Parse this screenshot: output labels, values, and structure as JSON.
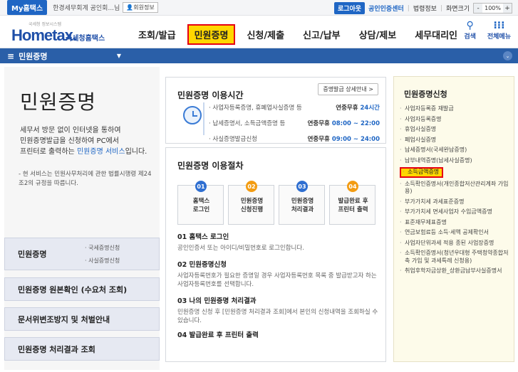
{
  "topbar": {
    "myhome": "My홈택스",
    "user": "한경세무회계 공인회...님",
    "member_info": "회원정보",
    "logout": "로그아웃",
    "cert_center": "공인인증센터",
    "law_info": "법령정보",
    "screen_size": "화면크기",
    "zoom_minus": "-",
    "zoom_value": "100%",
    "zoom_plus": "+"
  },
  "header": {
    "logo_small": "국세청 정보시스템",
    "logo_main": "Hometax.",
    "logo_sub": "국세청홈택스",
    "menu": [
      "조회/발급",
      "민원증명",
      "신청/제출",
      "신고/납부",
      "상담/제보",
      "세무대리인"
    ],
    "active_index": 1,
    "search": "검색",
    "all_menu": "전체메뉴"
  },
  "navbar": {
    "label": "민원증명"
  },
  "left": {
    "title": "민원증명",
    "desc_1": "세무서 방문 없이 인터넷을 통하여",
    "desc_2": "민원증명발급을 신청하여 PC에서",
    "desc_3a": "프린터로 출력하는 ",
    "desc_3b": "민원증명 서비스",
    "desc_3c": "입니다.",
    "note": "- 현 서비스는 민원사무처리에 관한 법률시행령 제24조2의 규정을 따릅니다.",
    "box1_label": "민원증명",
    "box1_sub1": "· 국세증명신청",
    "box1_sub2": "· 사실증명신청",
    "box2": "민원증명 원본확인 (수요처 조회)",
    "box3": "문서위변조방지 및 처벌안내",
    "box4": "민원증명 처리결과 조회"
  },
  "hours": {
    "title": "민원증명 이용시간",
    "detail_btn": "증명발급 상세안내 >",
    "rows": [
      {
        "k": "· 사업자등록증명, 휴폐업사실증명 등",
        "v1": "연중무휴 ",
        "v2": "24시간"
      },
      {
        "k": "· 납세증명서, 소득금액증명 등",
        "v1": "연중무휴 ",
        "v2": "08:00 ~ 22:00"
      },
      {
        "k": "· 사실증명발급신청",
        "v1": "연중무휴 ",
        "v2": "09:00 ~ 24:00"
      }
    ]
  },
  "procedure": {
    "title": "민원증명 이용절차",
    "steps": [
      {
        "num": "01",
        "l1": "홈택스",
        "l2": "로그인"
      },
      {
        "num": "02",
        "l1": "민원증명",
        "l2": "신청진행"
      },
      {
        "num": "03",
        "l1": "민원증명",
        "l2": "처리결과"
      },
      {
        "num": "04",
        "l1": "발급완료 후",
        "l2": "프린터 출력"
      }
    ],
    "sections": [
      {
        "h": "01 홈택스 로그인",
        "p": "공인인증서 또는 아이디/비밀번호로 로그인합니다."
      },
      {
        "h": "02 민원증명신청",
        "p": "사업자등록번호가 필요한 증명일 경우 사업자등록번호 목록 중 발급받고자 하는 사업자등록번호를 선택합니다."
      },
      {
        "h": "03 나의 민원증명 처리결과",
        "p": "민원증명 신청 후 [민원증명 처리결과 조회]에서 본인의 신청내역을 조회하실 수 있습니다."
      },
      {
        "h": "04 발급완료 후 프린터 출력",
        "p": ""
      }
    ]
  },
  "right": {
    "title": "민원증명신청",
    "items": [
      "사업자등록증 재발급",
      "사업자등록증명",
      "휴업사실증명",
      "폐업사실증명",
      "납세증명서(국세완납증명)",
      "납부내역증명(납세사실증명)",
      "소득금액증명",
      "소득확인증명서(개인종합저산관리계좌 가입용)",
      "부가가치세 과세표준증명",
      "부가가치세 면세사업자 수입금액증명",
      "표준재무제표증명",
      "연금보험료등 소득·세액 공제확인서",
      "사업자단위과세 적용 종된 사업장증명",
      "소득확인증명서(청년우대형 주택청약종합저축 가입 및 과세특례 신청용)",
      "취업후학자금상환_상환금납부사실증명서"
    ],
    "highlight_index": 6
  },
  "colors": {
    "brand_blue": "#1f66c4",
    "nav_blue": "#2a5fa8",
    "highlight_yellow": "#ffd700",
    "highlight_red": "#e60012",
    "step_orange": "#f39c12"
  }
}
